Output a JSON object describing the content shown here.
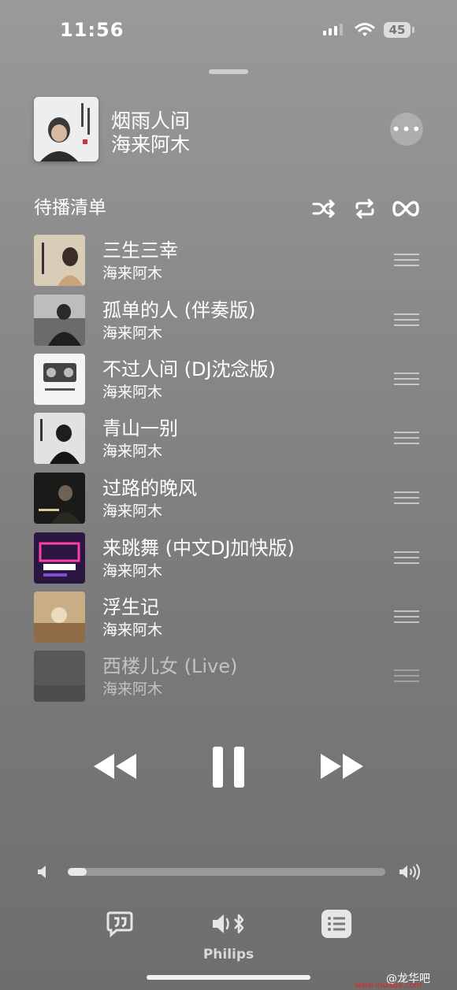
{
  "status_bar": {
    "time": "11:56",
    "battery": "45"
  },
  "now_playing": {
    "title": "烟雨人间",
    "artist": "海来阿木",
    "more_label": "•••"
  },
  "queue": {
    "label": "待播清单",
    "items": [
      {
        "title": "三生三幸",
        "artist": "海来阿木"
      },
      {
        "title": "孤单的人 (伴奏版)",
        "artist": "海来阿木"
      },
      {
        "title": "不过人间 (DJ沈念版)",
        "artist": "海来阿木"
      },
      {
        "title": "青山一别",
        "artist": "海来阿木"
      },
      {
        "title": "过路的晚风",
        "artist": "海来阿木"
      },
      {
        "title": "来跳舞 (中文DJ加快版)",
        "artist": "海来阿木"
      },
      {
        "title": "浮生记",
        "artist": "海来阿木"
      },
      {
        "title": "西楼儿女 (Live)",
        "artist": "海来阿木"
      }
    ]
  },
  "playback": {
    "state": "playing",
    "volume": 0.06
  },
  "output": {
    "device": "Philips"
  },
  "watermark": {
    "text": "@龙华吧",
    "url": "www.lhuaba.com"
  },
  "colors": {
    "background": "#8d8d8d",
    "text": "#ffffff"
  }
}
